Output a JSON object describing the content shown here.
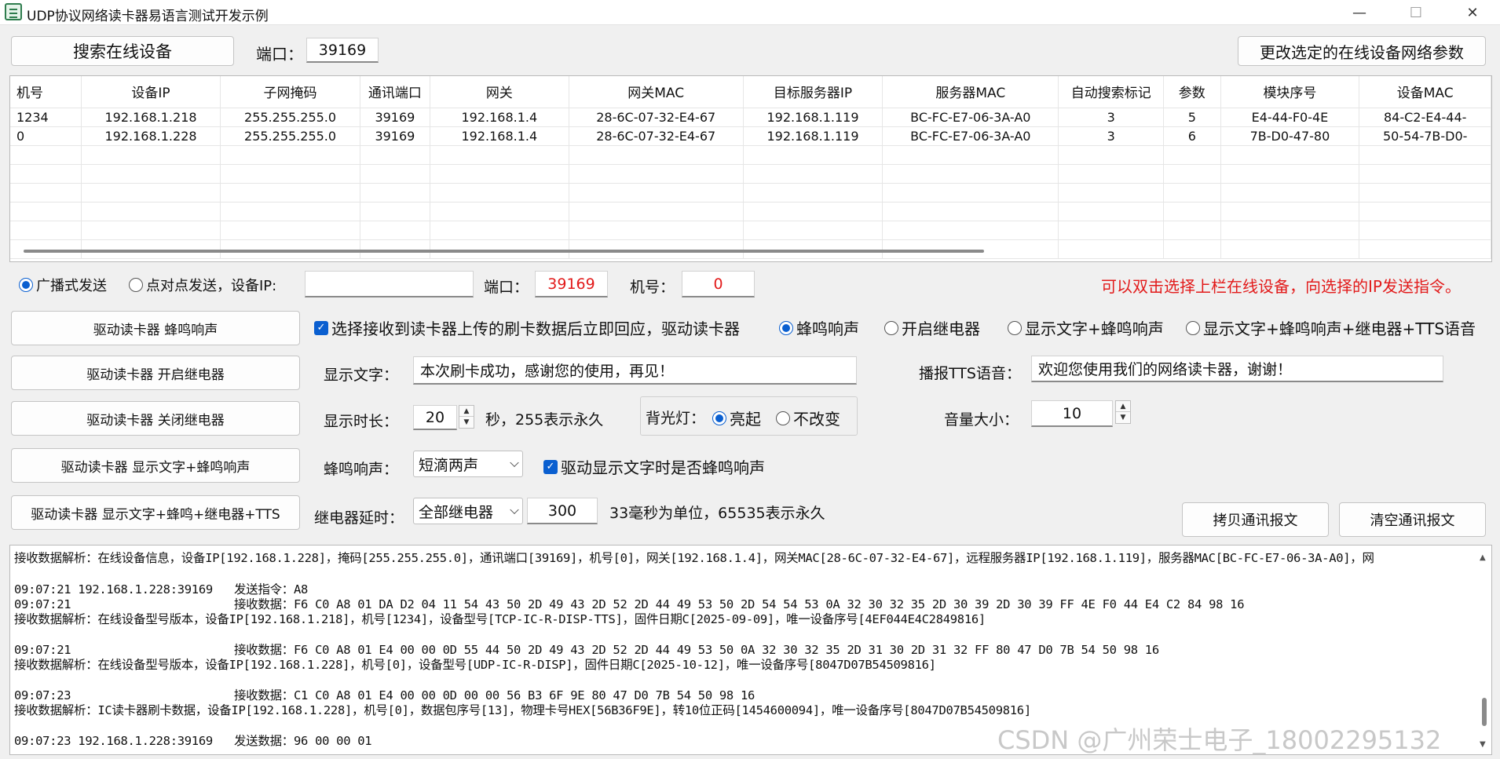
{
  "window": {
    "title": "UDP协议网络读卡器易语言测试开发示例",
    "minimize": "—",
    "maximize": "☐",
    "close": "✕"
  },
  "top": {
    "search_button": "搜索在线设备",
    "port_label": "端口：",
    "port_value": "39169",
    "modify_button": "更改选定的在线设备网络参数"
  },
  "table": {
    "columns": [
      "机号",
      "设备IP",
      "子网掩码",
      "通讯端口",
      "网关",
      "网关MAC",
      "目标服务器IP",
      "服务器MAC",
      "自动搜索标记",
      "参数",
      "模块序号",
      "设备MAC"
    ],
    "rows": [
      [
        "1234",
        "192.168.1.218",
        "255.255.255.0",
        "39169",
        "192.168.1.4",
        "28-6C-07-32-E4-67",
        "192.168.1.119",
        "BC-FC-E7-06-3A-A0",
        "3",
        "5",
        "E4-44-F0-4E",
        "84-C2-E4-44-"
      ],
      [
        "0",
        "192.168.1.228",
        "255.255.255.0",
        "39169",
        "192.168.1.4",
        "28-6C-07-32-E4-67",
        "192.168.1.119",
        "BC-FC-E7-06-3A-A0",
        "3",
        "6",
        "7B-D0-47-80",
        "50-54-7B-D0-"
      ]
    ]
  },
  "send": {
    "broadcast": "广播式发送",
    "p2p": "点对点发送，设备IP:",
    "ip_value": "",
    "port_label": "端口：",
    "port_value": "39169",
    "machine_label": "机号：",
    "machine_value": "0",
    "hint": "可以双击选择上栏在线设备，向选择的IP发送指令。"
  },
  "buttons": {
    "beep": "驱动读卡器 蜂鸣响声",
    "relay_on": "驱动读卡器 开启继电器",
    "relay_off": "驱动读卡器 关闭继电器",
    "display_beep": "驱动读卡器 显示文字+蜂鸣响声",
    "display_all": "驱动读卡器 显示文字+蜂鸣+继电器+TTS",
    "copy": "拷贝通讯报文",
    "clear": "清空通讯报文"
  },
  "reply": {
    "auto_reply": "选择接收到读卡器上传的刷卡数据后立即回应，驱动读卡器",
    "opt_beep": "蜂鸣响声",
    "opt_relay": "开启继电器",
    "opt_text_beep": "显示文字+蜂鸣响声",
    "opt_all": "显示文字+蜂鸣响声+继电器+TTS语音"
  },
  "fields": {
    "display_text_label": "显示文字：",
    "display_text": "本次刷卡成功，感谢您的使用，再见！",
    "tts_label": "播报TTS语音：",
    "tts_text": "欢迎您使用我们的网络读卡器，谢谢！",
    "duration_label": "显示时长：",
    "duration_value": "20",
    "duration_hint": "秒，255表示永久",
    "backlight_label": "背光灯：",
    "backlight_on": "亮起",
    "backlight_keep": "不改变",
    "volume_label": "音量大小：",
    "volume_value": "10",
    "beep_label": "蜂鸣响声：",
    "beep_value": "短滴两声",
    "beep_on_display": "驱动显示文字时是否蜂鸣响声",
    "relay_delay_label": "继电器延时：",
    "relay_select": "全部继电器",
    "relay_delay_value": "300",
    "relay_hint": "33毫秒为单位，65535表示永久"
  },
  "log": [
    "接收数据解析：在线设备信息，设备IP[192.168.1.228]，掩码[255.255.255.0]，通讯端口[39169]，机号[0]，网关[192.168.1.4]，网关MAC[28-6C-07-32-E4-67]，远程服务器IP[192.168.1.119]，服务器MAC[BC-FC-E7-06-3A-A0]，网",
    "",
    "09:07:21 192.168.1.228:39169   发送指令：A8",
    "09:07:21                       接收数据：F6 C0 A8 01 DA D2 04 11 54 43 50 2D 49 43 2D 52 2D 44 49 53 50 2D 54 54 53 0A 32 30 32 35 2D 30 39 2D 30 39 FF 4E F0 44 E4 C2 84 98 16",
    "接收数据解析：在线设备型号版本，设备IP[192.168.1.218]，机号[1234]，设备型号[TCP-IC-R-DISP-TTS]，固件日期C[2025-09-09]，唯一设备序号[4EF044E4C2849816]",
    "",
    "09:07:21                       接收数据：F6 C0 A8 01 E4 00 00 0D 55 44 50 2D 49 43 2D 52 2D 44 49 53 50 0A 32 30 32 35 2D 31 30 2D 31 32 FF 80 47 D0 7B 54 50 98 16",
    "接收数据解析：在线设备型号版本，设备IP[192.168.1.228]，机号[0]，设备型号[UDP-IC-R-DISP]，固件日期C[2025-10-12]，唯一设备序号[8047D07B54509816]",
    "",
    "09:07:23                       接收数据：C1 C0 A8 01 E4 00 00 0D 00 00 56 B3 6F 9E 80 47 D0 7B 54 50 98 16",
    "接收数据解析：IC读卡器刷卡数据，设备IP[192.168.1.228]，机号[0]，数据包序号[13]，物理卡号HEX[56B36F9E]，转10位正码[1454600094]，唯一设备序号[8047D07B54509816]",
    "",
    "09:07:23 192.168.1.228:39169   发送数据：96 00 00 01"
  ],
  "watermark": "CSDN @广州荣士电子_18002295132"
}
